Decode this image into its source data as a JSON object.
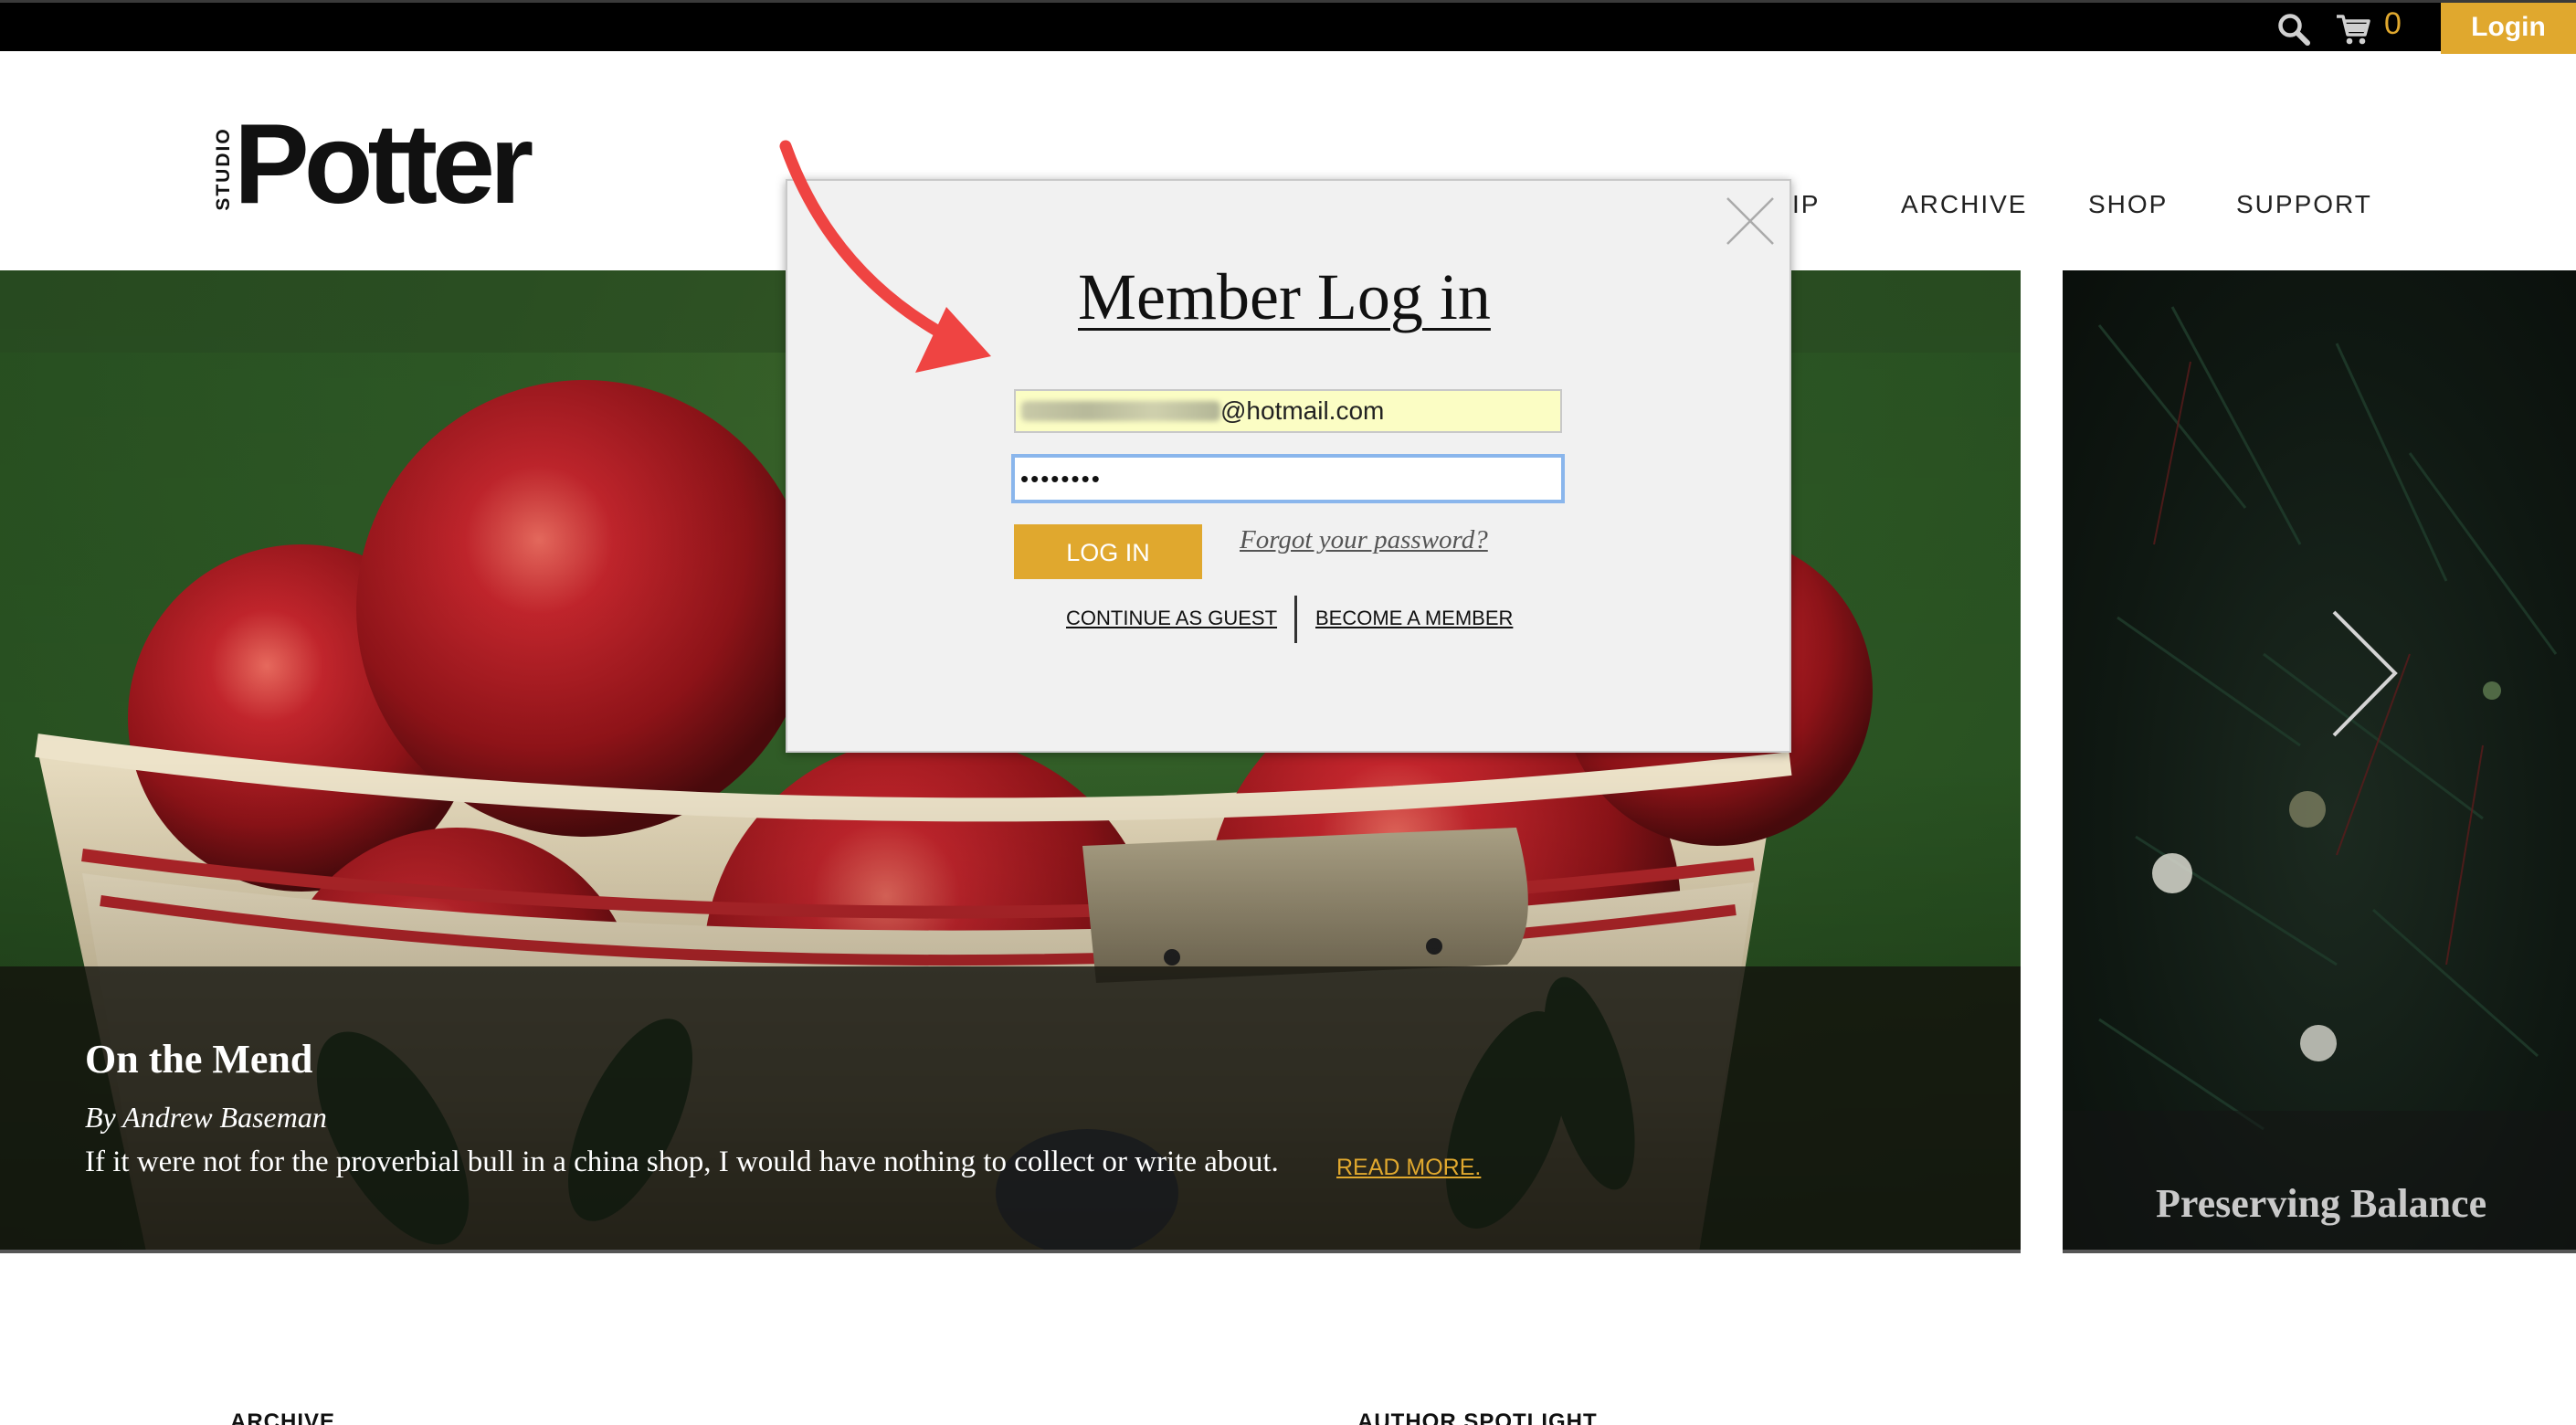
{
  "topbar": {
    "cart_count": "0",
    "login_label": "Login",
    "icons": [
      "search-icon",
      "cart-icon"
    ],
    "accent_color": "#e0a82e"
  },
  "header": {
    "logo_small": "STUDIO",
    "logo_main": "Potter",
    "nav": [
      "IP",
      "ARCHIVE",
      "SHOP",
      "SUPPORT"
    ]
  },
  "hero": {
    "title": "On the Mend",
    "author": "By Andrew Baseman",
    "excerpt": "If it were not for the proverbial bull in a china shop, I would have nothing to collect or write about.",
    "read_more": "READ MORE."
  },
  "hero_side": {
    "title": "Preserving Balance",
    "next_icon": "chevron-right-icon"
  },
  "sections": {
    "archive": "ARCHIVE",
    "author_spotlight": "AUTHOR SPOTLIGHT"
  },
  "modal": {
    "title": "Member Log in",
    "email_suffix": "@hotmail.com",
    "password_mask": "••••••••",
    "login_button": "LOG IN",
    "forgot_link": "Forgot your password?",
    "guest_link": "CONTINUE AS GUEST",
    "member_link": "BECOME A MEMBER",
    "close_icon": "close-icon"
  },
  "annotation": {
    "arrow_color": "#ef4442"
  }
}
